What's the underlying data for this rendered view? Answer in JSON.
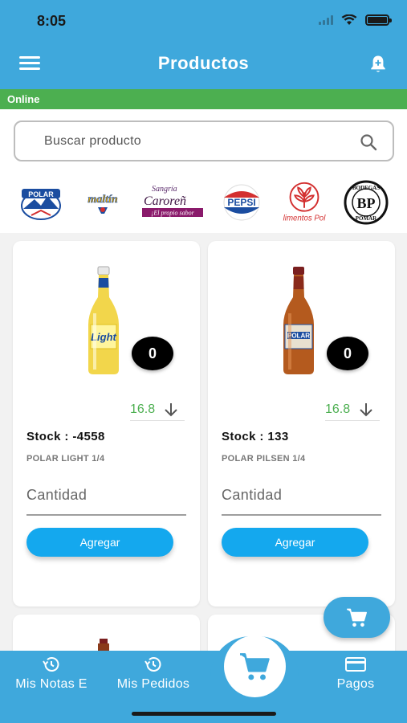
{
  "status_bar": {
    "time": "8:05"
  },
  "header": {
    "title": "Productos"
  },
  "connection": {
    "status": "Online"
  },
  "search": {
    "placeholder": "Buscar producto"
  },
  "brands": [
    {
      "name": "POLAR"
    },
    {
      "name": "maltín"
    },
    {
      "name": "Sangría Caroreña",
      "tagline": "¡El propio sabor"
    },
    {
      "name": "PEPSI"
    },
    {
      "name": "Alimentos Polar",
      "label": "limentos Pol"
    },
    {
      "name": "BODEGAS POMAR"
    }
  ],
  "products": [
    {
      "name": "POLAR LIGHT 1/4",
      "stock_label": "Stock :",
      "stock": "-4558",
      "price": "16.8",
      "cart_qty": "0",
      "qty_placeholder": "Cantidad",
      "add_label": "Agregar",
      "bottle_color": "#f2d64b"
    },
    {
      "name": "POLAR PILSEN 1/4",
      "stock_label": "Stock :",
      "stock": "133",
      "price": "16.8",
      "cart_qty": "0",
      "qty_placeholder": "Cantidad",
      "add_label": "Agregar",
      "bottle_color": "#b45a1e"
    }
  ],
  "bottom_nav": {
    "notas": "Mis Notas E",
    "pedidos": "Mis Pedidos",
    "pagos": "Pagos"
  },
  "colors": {
    "primary": "#3fa8dc",
    "online": "#4caf50",
    "button": "#14a8ee",
    "price": "#4caf50"
  }
}
